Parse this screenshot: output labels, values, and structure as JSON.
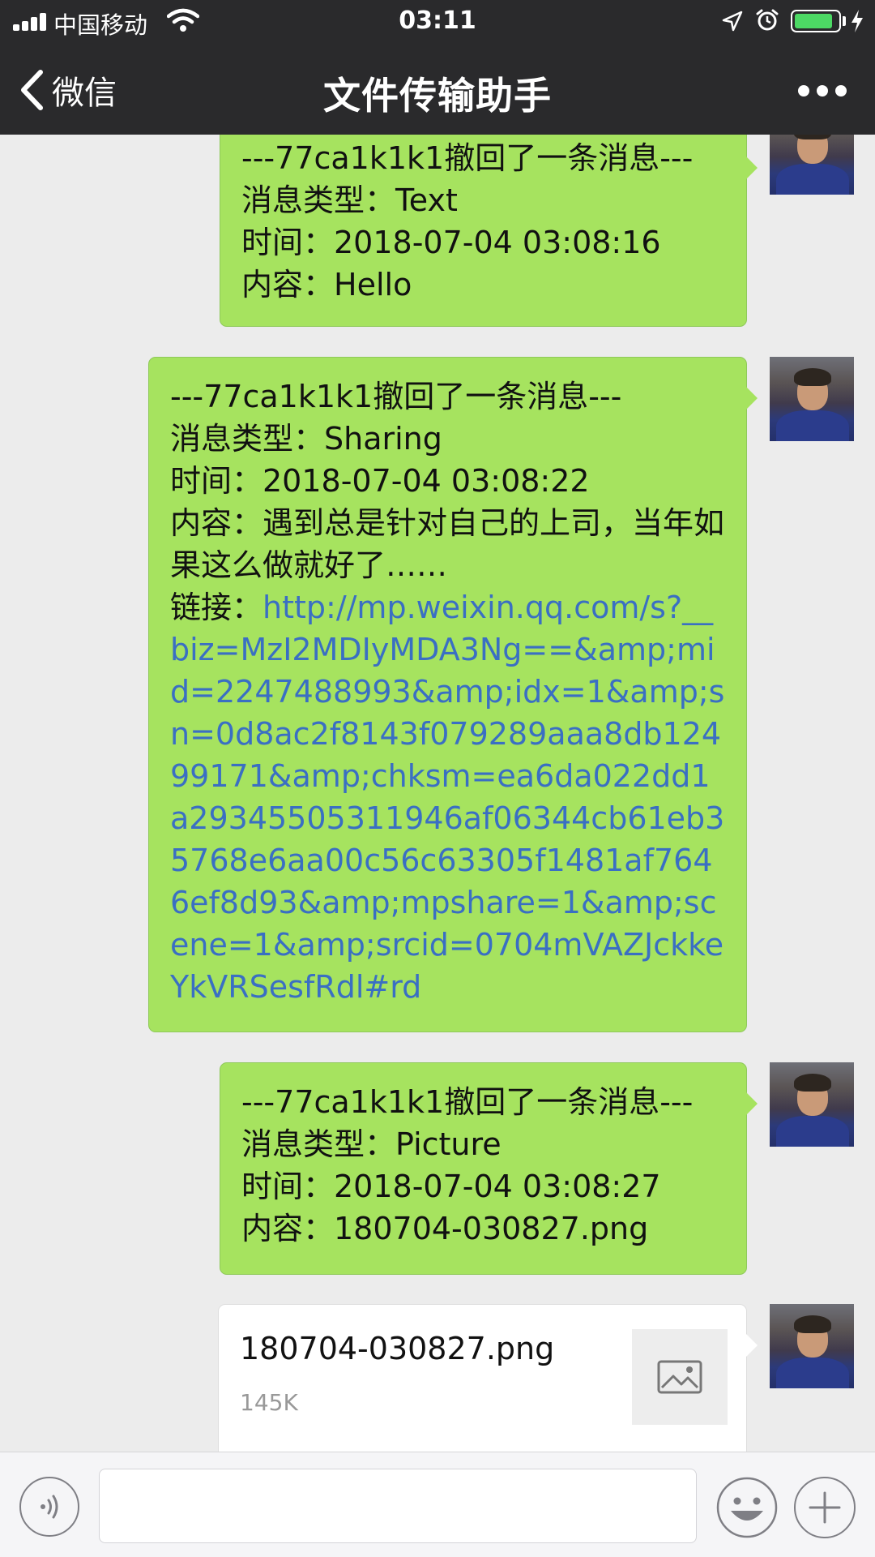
{
  "status_bar": {
    "carrier": "中国移动",
    "time": "03:11",
    "battery_level": 0.85
  },
  "nav": {
    "back_label": "微信",
    "title": "文件传输助手"
  },
  "messages": [
    {
      "header": "---77ca1k1k1撤回了一条消息---",
      "type_line": "消息类型：Text",
      "time_line": "时间：2018-07-04 03:08:16",
      "content_line": "内容：Hello"
    },
    {
      "header": "---77ca1k1k1撤回了一条消息---",
      "type_line": "消息类型：Sharing",
      "time_line": "时间：2018-07-04 03:08:22",
      "content_line": "内容：遇到总是针对自己的上司，当年如果这么做就好了……",
      "link_label": "链接：",
      "link_url": "http://mp.weixin.qq.com/s?__biz=MzI2MDIyMDA3Ng==&amp;mid=2247488993&amp;idx=1&amp;sn=0d8ac2f8143f079289aaa8db12499171&amp;chksm=ea6da022dd1a29345505311946af06344cb61eb35768e6aa00c56c63305f1481af7646ef8d93&amp;mpshare=1&amp;scene=1&amp;srcid=0704mVAZJckkeYkVRSesfRdl#rd"
    },
    {
      "header": "---77ca1k1k1撤回了一条消息---",
      "type_line": "消息类型：Picture",
      "time_line": "时间：2018-07-04 03:08:27",
      "content_line": "内容：180704-030827.png"
    }
  ],
  "file_card": {
    "name": "180704-030827.png",
    "size": "145K"
  },
  "icons": {
    "back": "chevron-left-icon",
    "more": "more-dots-icon",
    "voice": "voice-icon",
    "emoji": "emoji-icon",
    "plus": "plus-icon",
    "image": "image-icon"
  },
  "colors": {
    "header_bg": "#2a2a2c",
    "bubble": "#a6e35f",
    "link": "#3a6fc3",
    "chat_bg": "#ececec"
  }
}
